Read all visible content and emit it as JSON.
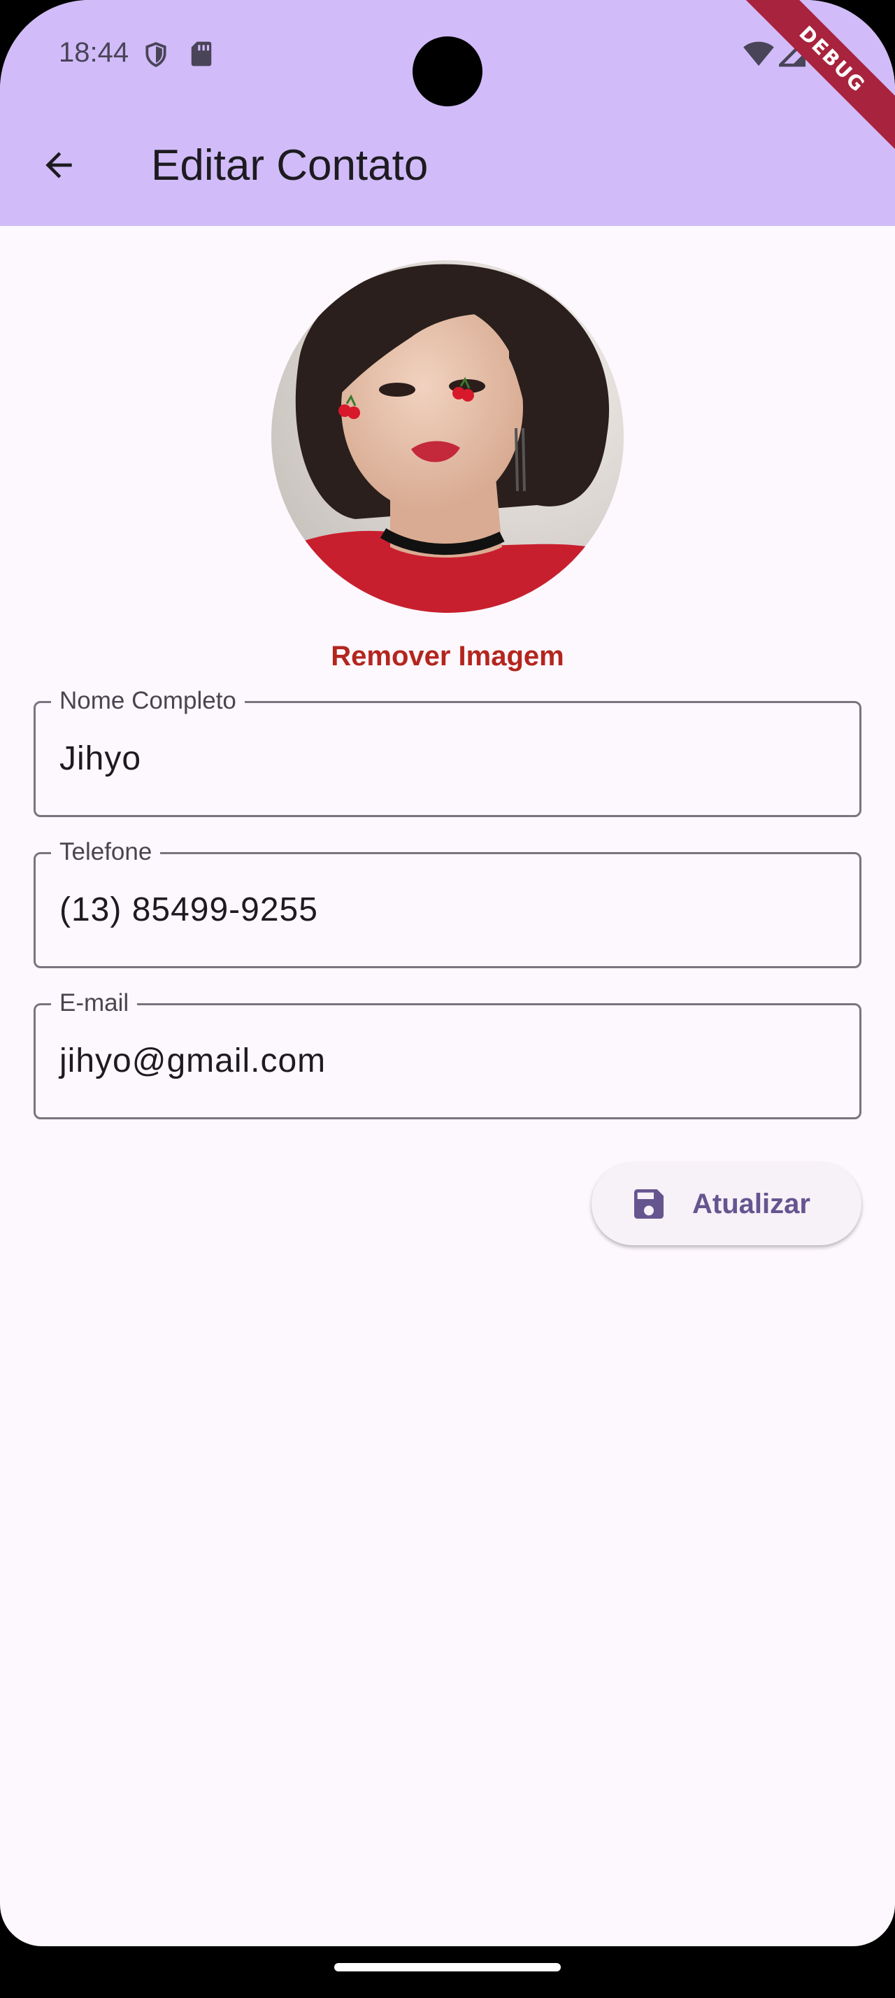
{
  "status_bar": {
    "time": "18:44",
    "debug_label": "DEBUG"
  },
  "app_bar": {
    "title": "Editar Contato",
    "back_icon": "arrow-back-icon"
  },
  "avatar": {
    "remove_label": "Remover Imagem"
  },
  "form": {
    "name": {
      "label": "Nome Completo",
      "value": "Jihyo"
    },
    "phone": {
      "label": "Telefone",
      "value": "(13) 85499-9255"
    },
    "email": {
      "label": "E-mail",
      "value": "jihyo@gmail.com"
    }
  },
  "actions": {
    "update_label": "Atualizar",
    "update_icon": "save-icon"
  },
  "colors": {
    "app_bar": "#d1bcf9",
    "background": "#fdf7fe",
    "remove_text": "#b3261e",
    "button_text": "#65558f",
    "outline": "#79747e"
  }
}
